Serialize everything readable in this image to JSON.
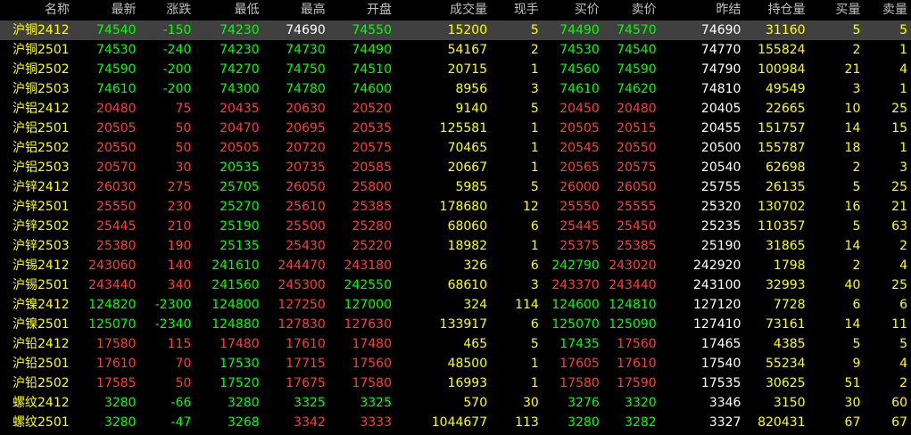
{
  "colors": {
    "background": "#000000",
    "up": "#ff3c3c",
    "down": "#00ff00",
    "flat": "#ffffff",
    "neutral": "#ffff00",
    "header": "#c0c0c0",
    "selected_row_bg": "#404040"
  },
  "headers": [
    "名称",
    "最新",
    "涨跌",
    "最低",
    "最高",
    "开盘",
    "成交量",
    "现手",
    "买价",
    "卖价",
    "昨结",
    "持仓量",
    "买量",
    "卖量"
  ],
  "rows": [
    {
      "name": "沪铜2412",
      "last": "74540",
      "change": "-150",
      "low": "74230",
      "high": "74690",
      "open": "74550",
      "volume": "15200",
      "cur": "5",
      "bid": "74490",
      "ask": "74570",
      "prev": "74690",
      "oi": "31160",
      "bidvol": "5",
      "askvol": "5",
      "dir": "down",
      "selected": true
    },
    {
      "name": "沪铜2501",
      "last": "74530",
      "change": "-240",
      "low": "74230",
      "high": "74730",
      "open": "74490",
      "volume": "54167",
      "cur": "2",
      "bid": "74530",
      "ask": "74540",
      "prev": "74770",
      "oi": "155824",
      "bidvol": "2",
      "askvol": "1",
      "dir": "down"
    },
    {
      "name": "沪铜2502",
      "last": "74590",
      "change": "-200",
      "low": "74270",
      "high": "74750",
      "open": "74510",
      "volume": "20715",
      "cur": "1",
      "bid": "74560",
      "ask": "74590",
      "prev": "74790",
      "oi": "100984",
      "bidvol": "21",
      "askvol": "4",
      "dir": "down"
    },
    {
      "name": "沪铜2503",
      "last": "74610",
      "change": "-200",
      "low": "74300",
      "high": "74780",
      "open": "74600",
      "volume": "8956",
      "cur": "3",
      "bid": "74610",
      "ask": "74620",
      "prev": "74810",
      "oi": "49549",
      "bidvol": "3",
      "askvol": "1",
      "dir": "down"
    },
    {
      "name": "沪铝2412",
      "last": "20480",
      "change": "75",
      "low": "20435",
      "high": "20630",
      "open": "20520",
      "volume": "9140",
      "cur": "5",
      "bid": "20450",
      "ask": "20480",
      "prev": "20405",
      "oi": "22665",
      "bidvol": "10",
      "askvol": "25",
      "dir": "up"
    },
    {
      "name": "沪铝2501",
      "last": "20505",
      "change": "50",
      "low": "20470",
      "high": "20695",
      "open": "20535",
      "volume": "125581",
      "cur": "1",
      "bid": "20505",
      "ask": "20515",
      "prev": "20455",
      "oi": "151757",
      "bidvol": "14",
      "askvol": "15",
      "dir": "up"
    },
    {
      "name": "沪铝2502",
      "last": "20550",
      "change": "50",
      "low": "20505",
      "high": "20720",
      "open": "20575",
      "volume": "70465",
      "cur": "1",
      "bid": "20545",
      "ask": "20550",
      "prev": "20500",
      "oi": "155787",
      "bidvol": "18",
      "askvol": "1",
      "dir": "up"
    },
    {
      "name": "沪铝2503",
      "last": "20570",
      "change": "30",
      "low": "20535",
      "high": "20735",
      "open": "20585",
      "volume": "20667",
      "cur": "1",
      "bid": "20565",
      "ask": "20575",
      "prev": "20540",
      "oi": "62698",
      "bidvol": "2",
      "askvol": "3",
      "dir": "up"
    },
    {
      "name": "沪锌2412",
      "last": "26030",
      "change": "275",
      "low": "25705",
      "high": "26050",
      "open": "25800",
      "volume": "5985",
      "cur": "5",
      "bid": "26000",
      "ask": "26050",
      "prev": "25755",
      "oi": "26135",
      "bidvol": "5",
      "askvol": "25",
      "dir": "up"
    },
    {
      "name": "沪锌2501",
      "last": "25550",
      "change": "230",
      "low": "25270",
      "high": "25610",
      "open": "25385",
      "volume": "178680",
      "cur": "12",
      "bid": "25550",
      "ask": "25555",
      "prev": "25320",
      "oi": "130702",
      "bidvol": "16",
      "askvol": "21",
      "dir": "up"
    },
    {
      "name": "沪锌2502",
      "last": "25445",
      "change": "210",
      "low": "25190",
      "high": "25500",
      "open": "25280",
      "volume": "68060",
      "cur": "6",
      "bid": "25445",
      "ask": "25450",
      "prev": "25235",
      "oi": "110357",
      "bidvol": "5",
      "askvol": "63",
      "dir": "up"
    },
    {
      "name": "沪锌2503",
      "last": "25380",
      "change": "190",
      "low": "25135",
      "high": "25430",
      "open": "25220",
      "volume": "18982",
      "cur": "1",
      "bid": "25375",
      "ask": "25385",
      "prev": "25190",
      "oi": "31865",
      "bidvol": "14",
      "askvol": "2",
      "dir": "up"
    },
    {
      "name": "沪锡2412",
      "last": "243060",
      "change": "140",
      "low": "241610",
      "high": "244470",
      "open": "243180",
      "volume": "326",
      "cur": "6",
      "bid": "242790",
      "ask": "243020",
      "prev": "242920",
      "oi": "1798",
      "bidvol": "2",
      "askvol": "4",
      "dir": "up"
    },
    {
      "name": "沪锡2501",
      "last": "243440",
      "change": "340",
      "low": "241560",
      "high": "245300",
      "open": "242550",
      "volume": "68610",
      "cur": "3",
      "bid": "243370",
      "ask": "243440",
      "prev": "243100",
      "oi": "32993",
      "bidvol": "40",
      "askvol": "25",
      "dir": "up"
    },
    {
      "name": "沪镍2412",
      "last": "124820",
      "change": "-2300",
      "low": "124800",
      "high": "127250",
      "open": "127000",
      "volume": "324",
      "cur": "114",
      "bid": "124600",
      "ask": "124810",
      "prev": "127120",
      "oi": "7728",
      "bidvol": "6",
      "askvol": "6",
      "dir": "down"
    },
    {
      "name": "沪镍2501",
      "last": "125070",
      "change": "-2340",
      "low": "124880",
      "high": "127830",
      "open": "127630",
      "volume": "133917",
      "cur": "6",
      "bid": "125070",
      "ask": "125090",
      "prev": "127410",
      "oi": "73161",
      "bidvol": "14",
      "askvol": "11",
      "dir": "down"
    },
    {
      "name": "沪铅2412",
      "last": "17580",
      "change": "115",
      "low": "17480",
      "high": "17610",
      "open": "17480",
      "volume": "465",
      "cur": "5",
      "bid": "17435",
      "ask": "17560",
      "prev": "17465",
      "oi": "4385",
      "bidvol": "5",
      "askvol": "5",
      "dir": "up"
    },
    {
      "name": "沪铅2501",
      "last": "17610",
      "change": "70",
      "low": "17530",
      "high": "17715",
      "open": "17560",
      "volume": "48500",
      "cur": "1",
      "bid": "17605",
      "ask": "17610",
      "prev": "17540",
      "oi": "55234",
      "bidvol": "9",
      "askvol": "4",
      "dir": "up"
    },
    {
      "name": "沪铅2502",
      "last": "17585",
      "change": "50",
      "low": "17520",
      "high": "17675",
      "open": "17580",
      "volume": "16993",
      "cur": "1",
      "bid": "17580",
      "ask": "17590",
      "prev": "17535",
      "oi": "30625",
      "bidvol": "51",
      "askvol": "2",
      "dir": "up"
    },
    {
      "name": "螺纹2412",
      "last": "3280",
      "change": "-66",
      "low": "3280",
      "high": "3325",
      "open": "3325",
      "volume": "570",
      "cur": "30",
      "bid": "3276",
      "ask": "3320",
      "prev": "3346",
      "oi": "3150",
      "bidvol": "30",
      "askvol": "60",
      "dir": "down"
    },
    {
      "name": "螺纹2501",
      "last": "3280",
      "change": "-47",
      "low": "3268",
      "high": "3342",
      "open": "3333",
      "volume": "1044677",
      "cur": "113",
      "bid": "3280",
      "ask": "3282",
      "prev": "3327",
      "oi": "820431",
      "bidvol": "67",
      "askvol": "67",
      "dir": "down"
    }
  ]
}
